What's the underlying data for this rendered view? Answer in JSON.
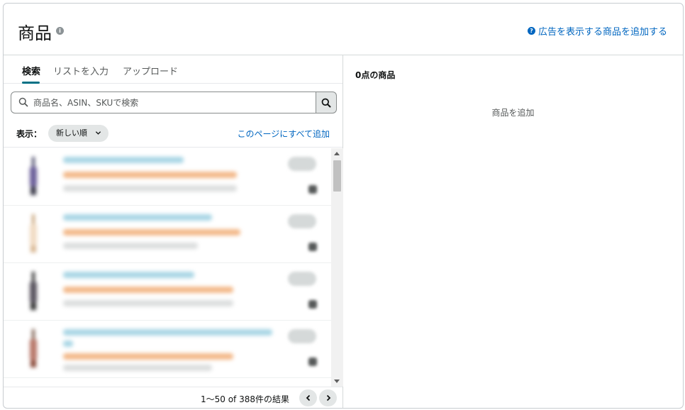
{
  "header": {
    "title": "商品",
    "info_icon": "info-icon",
    "help_link": "広告を表示する商品を追加する",
    "help_icon": "question-circle-icon"
  },
  "tabs": [
    {
      "label": "検索",
      "active": true
    },
    {
      "label": "リストを入力",
      "active": false
    },
    {
      "label": "アップロード",
      "active": false
    }
  ],
  "search": {
    "placeholder": "商品名、ASIN、SKUで検索",
    "value": "",
    "icon": "search-icon"
  },
  "sort": {
    "label": "表示：",
    "selected": "新しい順",
    "add_all_link": "このページにすべて追加"
  },
  "product_list": {
    "note": "product rows are blurred in the screenshot",
    "row_count_visible": 4
  },
  "pagination": {
    "results_text": "1〜50 of 388件の結果",
    "prev_icon": "chevron-left-icon",
    "next_icon": "chevron-right-icon"
  },
  "right_panel": {
    "title": "0点の商品",
    "empty_text": "商品を追加"
  },
  "colors": {
    "link": "#0066c0",
    "accent_tab": "#007185",
    "blurred_link": "#7fc3d8",
    "blurred_price": "#f0a86a"
  }
}
